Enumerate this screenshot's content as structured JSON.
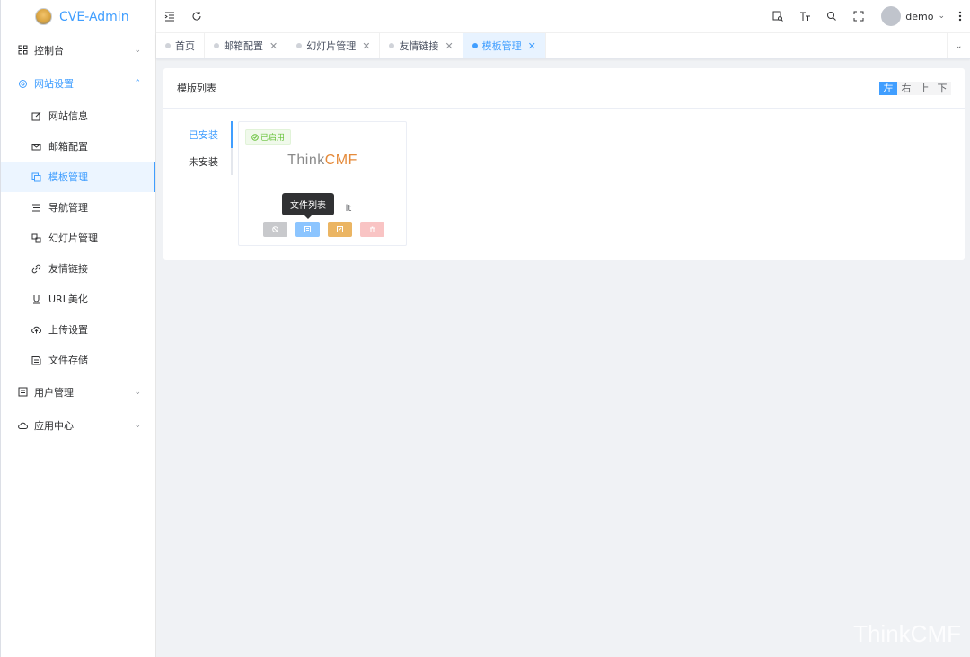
{
  "app": {
    "title": "CVE-Admin"
  },
  "sidebar": {
    "groups": [
      {
        "label": "控制台"
      },
      {
        "label": "网站设置"
      },
      {
        "label": "用户管理"
      },
      {
        "label": "应用中心"
      }
    ],
    "sub_items": [
      {
        "label": "网站信息"
      },
      {
        "label": "邮箱配置"
      },
      {
        "label": "模板管理"
      },
      {
        "label": "导航管理"
      },
      {
        "label": "幻灯片管理"
      },
      {
        "label": "友情链接"
      },
      {
        "label": "URL美化"
      },
      {
        "label": "上传设置"
      },
      {
        "label": "文件存储"
      }
    ]
  },
  "header": {
    "username": "demo"
  },
  "tags": [
    {
      "label": "首页"
    },
    {
      "label": "邮箱配置"
    },
    {
      "label": "幻灯片管理"
    },
    {
      "label": "友情链接"
    },
    {
      "label": "模板管理"
    }
  ],
  "card": {
    "title": "模版列表",
    "positions": [
      "左",
      "右",
      "上",
      "下"
    ],
    "tabs": [
      "已安装",
      "未安装"
    ]
  },
  "template": {
    "badge": "已启用",
    "logo_prefix": "Think",
    "logo_suffix": "CMF",
    "name_visible": "lt",
    "tooltip": "文件列表"
  },
  "watermark": "ThinkCMF",
  "colors": {
    "accent": "#409eff",
    "success": "#67c23a",
    "warning": "#ebb563",
    "danger": "#f9c4c4"
  }
}
